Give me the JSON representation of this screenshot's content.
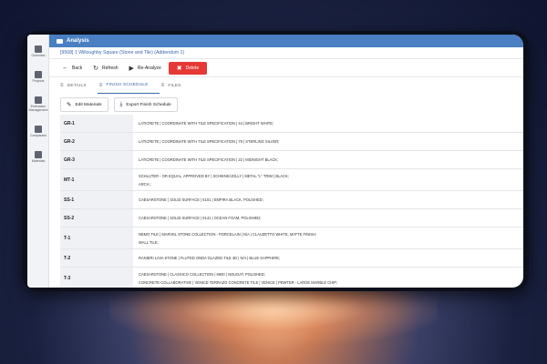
{
  "app": {
    "title": "Analysis"
  },
  "sidebar": {
    "items": [
      {
        "label": "Overview",
        "icon": "grid-icon"
      },
      {
        "label": "Projects",
        "icon": "folder-icon"
      },
      {
        "label": "Estimation Management",
        "icon": "calculator-icon"
      },
      {
        "label": "Companies",
        "icon": "building-icon"
      },
      {
        "label": "Materials",
        "icon": "layers-icon"
      }
    ]
  },
  "breadcrumb": "[9568] 1 Willoughby Square (Stone and Tile) (Addendum 1)",
  "actions": {
    "back": "Back",
    "refresh": "Refresh",
    "reanalyze": "Re-Analyze",
    "delete": "Delete"
  },
  "tabs": [
    {
      "label": "DETAILS"
    },
    {
      "label": "FINISH SCHEDULE"
    },
    {
      "label": "FILES"
    }
  ],
  "toolbar": {
    "edit_materials": "Edit Materials",
    "export": "Export Finish Schedule"
  },
  "schedule": [
    {
      "code": "GR-1",
      "lines": [
        "LATICRETE | COORDINATE WITH TILE SPECIFICATION | 44 | BRIGHT WHITE;"
      ]
    },
    {
      "code": "GR-2",
      "lines": [
        "LATICRETE | COORDINATE WITH TILE SPECIFICATION | 79 | STERLING SILVER;"
      ]
    },
    {
      "code": "GR-3",
      "lines": [
        "LATICRETE | COORDINATE WITH TILE SPECIFICATION | 22 | MIDNIGHT BLACK;"
      ]
    },
    {
      "code": "MT-1",
      "lines": [
        "SCHLUTER - OR EQUAL, APPROVED BY | SCHIENE/JOLLY | METAL \"L\" TRIM | BLACK;",
        "ARCH.;"
      ]
    },
    {
      "code": "SS-1",
      "lines": [
        "CAESARSTONE | SOLID SURFACE | 5101 | EMPIRA BLACK, POLISHED;"
      ]
    },
    {
      "code": "SS-2",
      "lines": [
        "CAESARSTONE | SOLID SURFACE | 6141 | OCEAN FOAM, POLISHED;"
      ]
    },
    {
      "code": "T-1",
      "lines": [
        "NEMO TILE | MARVEL STONE COLLECTION - PORCELAIN | N/A | CLAUZETTO WHITE, MATTE FINISH;",
        "WALL TILE;"
      ]
    },
    {
      "code": "T-2",
      "lines": [
        "RANIERI LAVA STONE | FLUTED ONDA GLAZED TILE 3D | N/A | BLUE SAPPHIRE;"
      ]
    },
    {
      "code": "T-3",
      "lines": [
        "CAESARSTONE | CLASSICO COLLECTION | 6600 | NOUGAT, POLISHED;",
        "CONCRETE-COLLABORATIVE | VENICE TERRAZO CONCRETE TILE | VENICE | PEWTER - LARGE MARBLE CHIP;"
      ]
    }
  ]
}
